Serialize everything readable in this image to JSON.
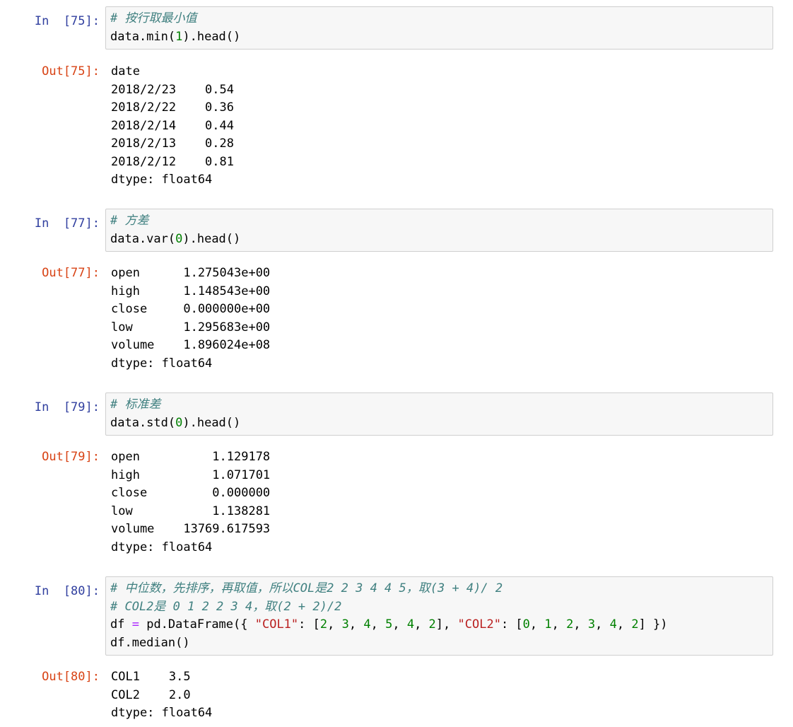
{
  "cells": [
    {
      "in_prompt": "In  [75]:",
      "code": [
        [
          {
            "t": "# 按行取最小值",
            "c": "cm"
          }
        ],
        [
          {
            "t": "data.min("
          },
          {
            "t": "1",
            "c": "nm"
          },
          {
            "t": ").head()"
          }
        ]
      ],
      "out_prompt": "Out[75]:",
      "output": [
        "date",
        "2018/2/23    0.54",
        "2018/2/22    0.36",
        "2018/2/14    0.44",
        "2018/2/13    0.28",
        "2018/2/12    0.81",
        "dtype: float64"
      ]
    },
    {
      "in_prompt": "In  [77]:",
      "code": [
        [
          {
            "t": "# 方差",
            "c": "cm"
          }
        ],
        [
          {
            "t": "data.var("
          },
          {
            "t": "0",
            "c": "nm"
          },
          {
            "t": ").head()"
          }
        ]
      ],
      "out_prompt": "Out[77]:",
      "output": [
        "open      1.275043e+00",
        "high      1.148543e+00",
        "close     0.000000e+00",
        "low       1.295683e+00",
        "volume    1.896024e+08",
        "dtype: float64"
      ]
    },
    {
      "in_prompt": "In  [79]:",
      "code": [
        [
          {
            "t": "# 标准差",
            "c": "cm"
          }
        ],
        [
          {
            "t": "data.std("
          },
          {
            "t": "0",
            "c": "nm"
          },
          {
            "t": ").head()"
          }
        ]
      ],
      "out_prompt": "Out[79]:",
      "output": [
        "open          1.129178",
        "high          1.071701",
        "close         0.000000",
        "low           1.138281",
        "volume    13769.617593",
        "dtype: float64"
      ]
    },
    {
      "in_prompt": "In  [80]:",
      "code": [
        [
          {
            "t": "# 中位数，先排序，再取值，所以COL是2 2 3 4 4 5，取(3 + 4)/ 2",
            "c": "cm"
          }
        ],
        [
          {
            "t": "# COL2是 0 1 2 2 3 4，取(2 + 2)/2",
            "c": "cm"
          }
        ],
        [
          {
            "t": "df "
          },
          {
            "t": "=",
            "c": "op"
          },
          {
            "t": " pd.DataFrame({ "
          },
          {
            "t": "\"COL1\"",
            "c": "st"
          },
          {
            "t": ": ["
          },
          {
            "t": "2",
            "c": "nm"
          },
          {
            "t": ", "
          },
          {
            "t": "3",
            "c": "nm"
          },
          {
            "t": ", "
          },
          {
            "t": "4",
            "c": "nm"
          },
          {
            "t": ", "
          },
          {
            "t": "5",
            "c": "nm"
          },
          {
            "t": ", "
          },
          {
            "t": "4",
            "c": "nm"
          },
          {
            "t": ", "
          },
          {
            "t": "2",
            "c": "nm"
          },
          {
            "t": "], "
          },
          {
            "t": "\"COL2\"",
            "c": "st"
          },
          {
            "t": ": ["
          },
          {
            "t": "0",
            "c": "nm"
          },
          {
            "t": ", "
          },
          {
            "t": "1",
            "c": "nm"
          },
          {
            "t": ", "
          },
          {
            "t": "2",
            "c": "nm"
          },
          {
            "t": ", "
          },
          {
            "t": "3",
            "c": "nm"
          },
          {
            "t": ", "
          },
          {
            "t": "4",
            "c": "nm"
          },
          {
            "t": ", "
          },
          {
            "t": "2",
            "c": "nm"
          },
          {
            "t": "] })"
          }
        ],
        [
          {
            "t": "df.median()"
          }
        ]
      ],
      "out_prompt": "Out[80]:",
      "output": [
        "COL1    3.5",
        "COL2    2.0",
        "dtype: float64"
      ]
    }
  ]
}
